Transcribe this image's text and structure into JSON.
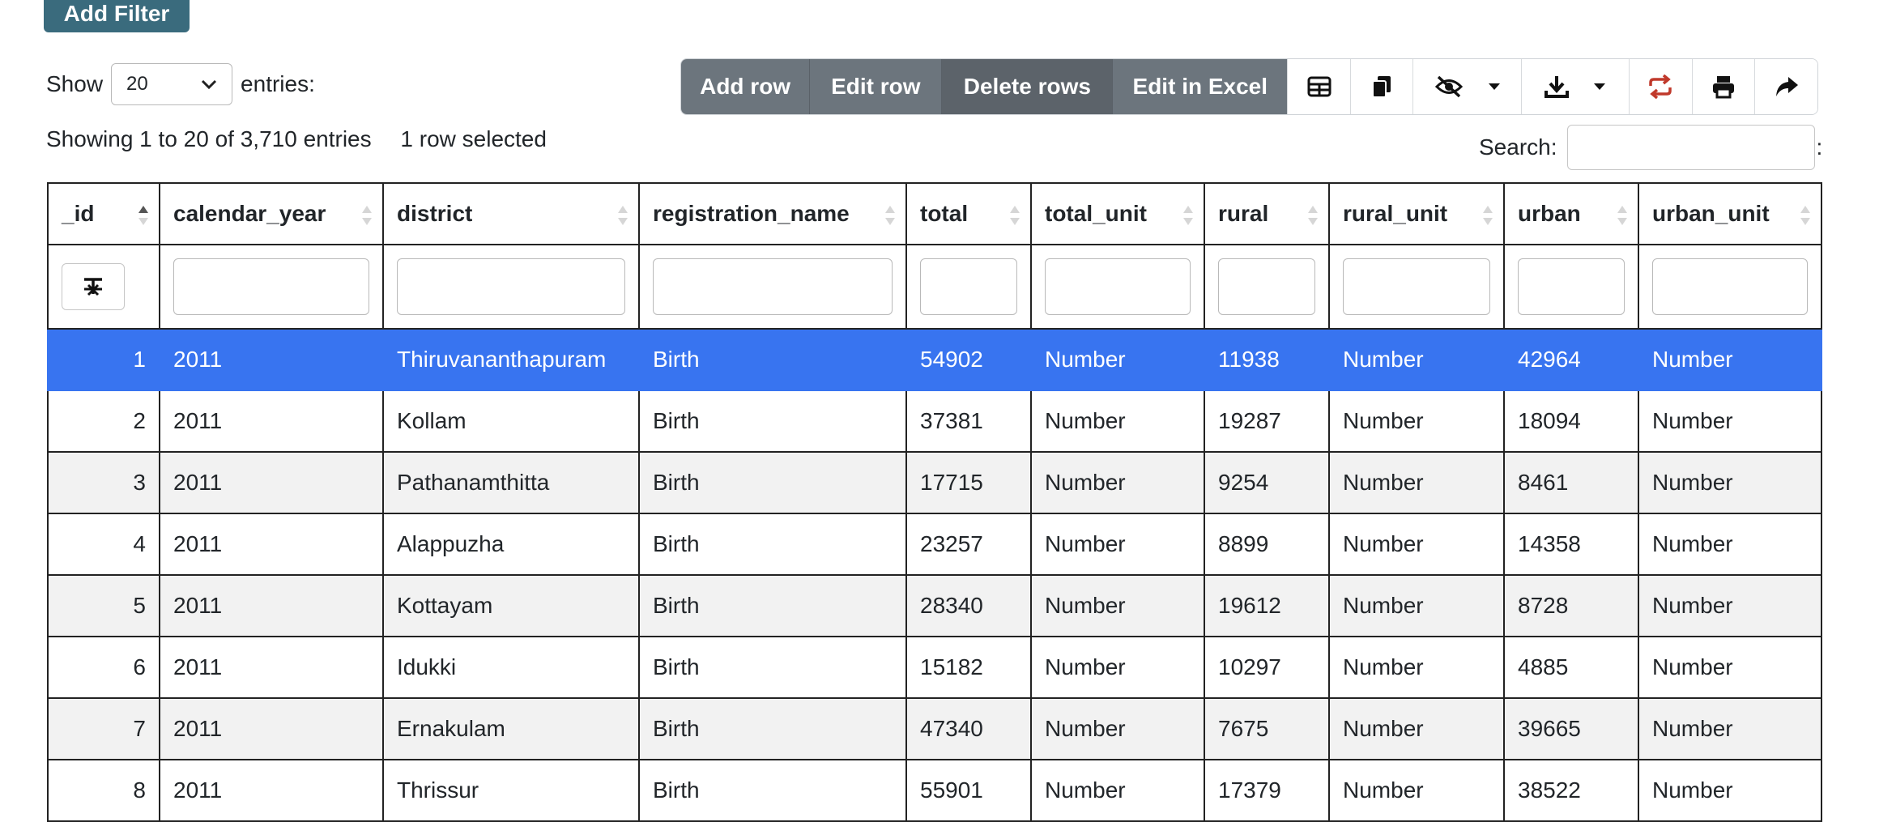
{
  "add_filter_label": "Add Filter",
  "length": {
    "show": "Show",
    "value": "20",
    "entries": "entries:"
  },
  "info": {
    "showing": "Showing 1 to 20 of 3,710 entries",
    "selected": "1 row selected"
  },
  "toolbar": {
    "add_row": "Add row",
    "edit_row": "Edit row",
    "delete_rows": "Delete rows",
    "edit_excel": "Edit in Excel"
  },
  "search_label": "Search:",
  "search_value": "",
  "search_suffix": ":",
  "columns": [
    "_id",
    "calendar_year",
    "district",
    "registration_name",
    "total",
    "total_unit",
    "rural",
    "rural_unit",
    "urban",
    "urban_unit"
  ],
  "rows": [
    [
      "1",
      "2011",
      "Thiruvananthapuram",
      "Birth",
      "54902",
      "Number",
      "11938",
      "Number",
      "42964",
      "Number"
    ],
    [
      "2",
      "2011",
      "Kollam",
      "Birth",
      "37381",
      "Number",
      "19287",
      "Number",
      "18094",
      "Number"
    ],
    [
      "3",
      "2011",
      "Pathanamthitta",
      "Birth",
      "17715",
      "Number",
      "9254",
      "Number",
      "8461",
      "Number"
    ],
    [
      "4",
      "2011",
      "Alappuzha",
      "Birth",
      "23257",
      "Number",
      "8899",
      "Number",
      "14358",
      "Number"
    ],
    [
      "5",
      "2011",
      "Kottayam",
      "Birth",
      "28340",
      "Number",
      "19612",
      "Number",
      "8728",
      "Number"
    ],
    [
      "6",
      "2011",
      "Idukki",
      "Birth",
      "15182",
      "Number",
      "10297",
      "Number",
      "4885",
      "Number"
    ],
    [
      "7",
      "2011",
      "Ernakulam",
      "Birth",
      "47340",
      "Number",
      "7675",
      "Number",
      "39665",
      "Number"
    ],
    [
      "8",
      "2011",
      "Thrissur",
      "Birth",
      "55901",
      "Number",
      "17379",
      "Number",
      "38522",
      "Number"
    ]
  ],
  "colors": {
    "selected": "#3874f0",
    "add_filter": "#3a6b7d",
    "toolbar": "#6c757d",
    "refresh_icon": "#c0392b"
  },
  "icons": [
    "table-icon",
    "copy-icon",
    "eye-slash-icon",
    "caret-down-icon",
    "download-icon",
    "refresh-icon",
    "print-icon",
    "share-icon"
  ]
}
